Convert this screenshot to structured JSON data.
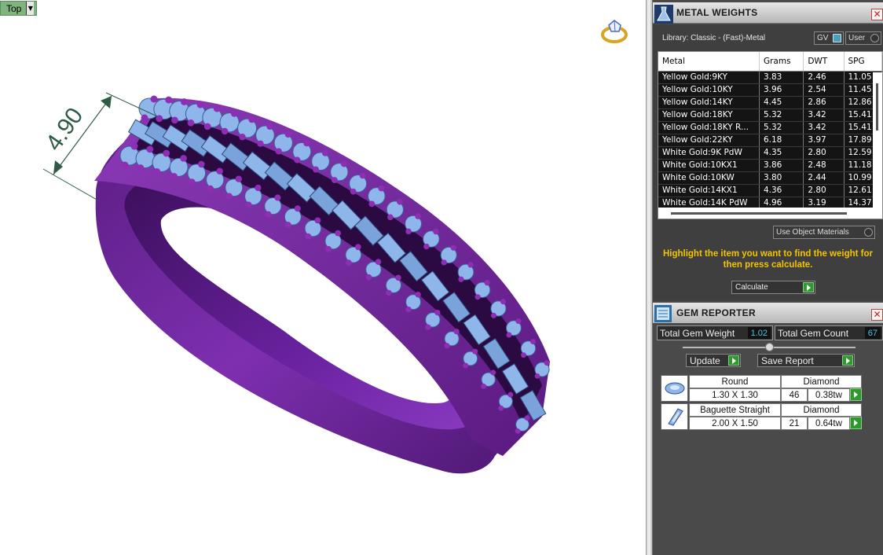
{
  "viewport": {
    "view_name": "Top",
    "dimension_value": "4.90",
    "colors": {
      "metal": "#7a2aa8",
      "gem": "#8fb6ea",
      "prong": "#8e2eb4",
      "dimension": "#2e5b45"
    }
  },
  "metal_weights": {
    "title": "METAL WEIGHTS",
    "library": "Library: Classic - (Fast)-Metal",
    "gv_label": "GV",
    "user_label": "User",
    "columns": [
      "Metal",
      "Grams",
      "DWT",
      "SPG"
    ],
    "rows": [
      [
        "Yellow Gold:9KY",
        "3.83",
        "2.46",
        "11.05"
      ],
      [
        "Yellow Gold:10KY",
        "3.96",
        "2.54",
        "11.45"
      ],
      [
        "Yellow Gold:14KY",
        "4.45",
        "2.86",
        "12.86"
      ],
      [
        "Yellow Gold:18KY",
        "5.32",
        "3.42",
        "15.41"
      ],
      [
        "Yellow Gold:18KY R...",
        "5.32",
        "3.42",
        "15.41"
      ],
      [
        "Yellow Gold:22KY",
        "6.18",
        "3.97",
        "17.89"
      ],
      [
        "White Gold:9K PdW",
        "4.35",
        "2.80",
        "12.59"
      ],
      [
        "White Gold:10KX1",
        "3.86",
        "2.48",
        "11.18"
      ],
      [
        "White Gold:10KW",
        "3.80",
        "2.44",
        "10.99"
      ],
      [
        "White Gold:14KX1",
        "4.36",
        "2.80",
        "12.61"
      ],
      [
        "White Gold:14K PdW",
        "4.96",
        "3.19",
        "14.37"
      ]
    ],
    "use_object_materials": "Use Object Materials",
    "message": "Highlight the item you want to find the weight for then press calculate.",
    "calculate_label": "Calculate"
  },
  "gem_reporter": {
    "title": "GEM REPORTER",
    "total_weight_label": "Total Gem Weight",
    "total_weight_value": "1.02",
    "total_count_label": "Total Gem Count",
    "total_count_value": "67",
    "update_label": "Update",
    "save_report_label": "Save Report",
    "gems": [
      {
        "shape": "Round",
        "size": "1.30 X 1.30",
        "material": "Diamond",
        "count": "46",
        "weight": "0.38tw",
        "icon": "round-gem-icon"
      },
      {
        "shape": "Baguette Straight",
        "size": "2.00 X 1.50",
        "material": "Diamond",
        "count": "21",
        "weight": "0.64tw",
        "icon": "baguette-gem-icon"
      }
    ]
  }
}
